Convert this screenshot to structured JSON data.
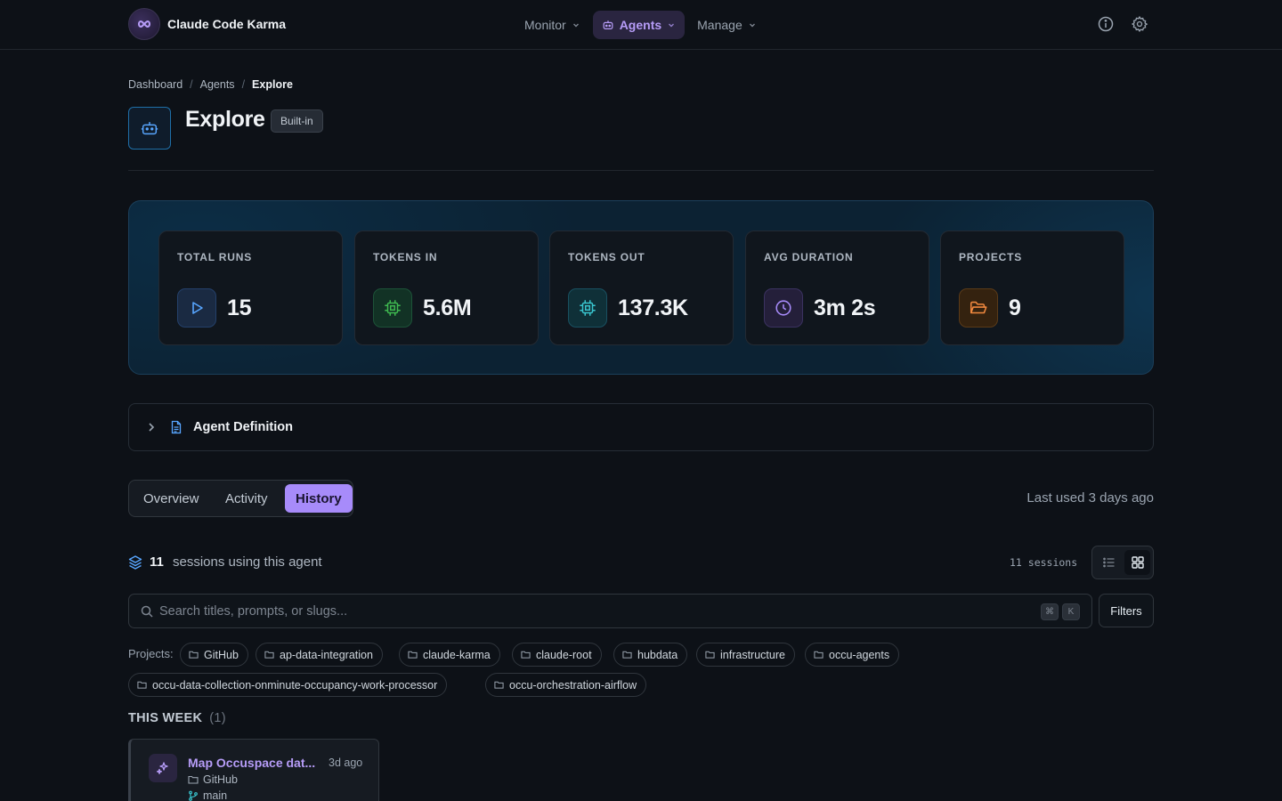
{
  "app": {
    "name": "Claude Code Karma"
  },
  "nav": {
    "items": [
      {
        "label": "Monitor",
        "active": false
      },
      {
        "label": "Agents",
        "active": true
      },
      {
        "label": "Manage",
        "active": false
      }
    ]
  },
  "breadcrumb": [
    "Dashboard",
    "Agents",
    "Explore"
  ],
  "agent": {
    "name": "Explore",
    "badge": "Built-in"
  },
  "stats": [
    {
      "label": "TOTAL RUNS",
      "value": "15",
      "icon": "play-icon",
      "color": "#58a6ff"
    },
    {
      "label": "TOKENS IN",
      "value": "5.6M",
      "icon": "cpu-icon",
      "color": "#3fb950"
    },
    {
      "label": "TOKENS OUT",
      "value": "137.3K",
      "icon": "cpu-icon",
      "color": "#39c5cf"
    },
    {
      "label": "AVG DURATION",
      "value": "3m 2s",
      "icon": "clock-icon",
      "color": "#a78bfa"
    },
    {
      "label": "PROJECTS",
      "value": "9",
      "icon": "folder-open-icon",
      "color": "#f0883e"
    }
  ],
  "definition": {
    "label": "Agent Definition"
  },
  "tabs": [
    {
      "label": "Overview",
      "active": false
    },
    {
      "label": "Activity",
      "active": false
    },
    {
      "label": "History",
      "active": true
    }
  ],
  "last_used": "Last used 3 days ago",
  "sessions": {
    "count": "11",
    "text": "sessions using this agent",
    "mono": "11 sessions"
  },
  "search": {
    "placeholder": "Search titles, prompts, or slugs...",
    "value": "",
    "kbd": [
      "⌘",
      "K"
    ]
  },
  "filters_label": "Filters",
  "projects": {
    "label": "Projects:",
    "chips": [
      "GitHub",
      "ap-data-integration",
      "claude-karma",
      "claude-root",
      "hubdata",
      "infrastructure",
      "occu-agents",
      "occu-data-collection-onminute-occupancy-work-processor",
      "occu-orchestration-airflow"
    ]
  },
  "week": {
    "label": "THIS WEEK",
    "count": "(1)"
  },
  "session_card": {
    "title": "Map Occuspace dat...",
    "time": "3d ago",
    "project": "GitHub",
    "branch": "main"
  },
  "colors": {
    "accent": "#a78bfa",
    "background": "#0d1117"
  }
}
